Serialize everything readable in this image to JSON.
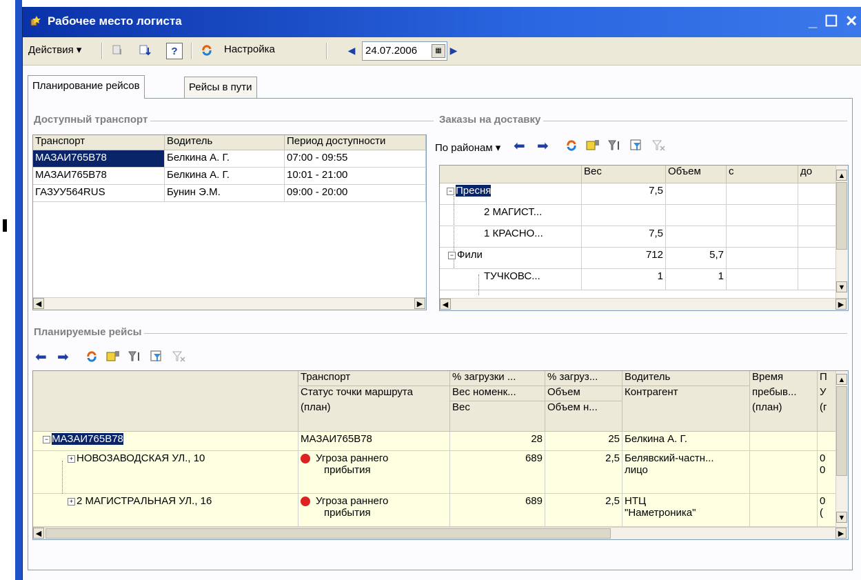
{
  "window": {
    "title": "Рабочее место логиста"
  },
  "toolbar": {
    "actions_label": "Действия ▾",
    "help_label": "?",
    "settings_label": "Настройка",
    "date": "24.07.2006"
  },
  "tabs": [
    {
      "label": "Планирование рейсов",
      "active": true
    },
    {
      "label": "Рейсы в пути",
      "active": false
    }
  ],
  "transport": {
    "group_label": "Доступный транспорт",
    "columns": [
      "Транспорт",
      "Водитель",
      "Период доступности"
    ],
    "rows": [
      [
        "МАЗАИ765В78",
        "Белкина А. Г.",
        "07:00 - 09:55"
      ],
      [
        "МАЗАИ765В78",
        "Белкина А. Г.",
        "10:01 - 21:00"
      ],
      [
        "ГАЗУУ564RUS",
        "Бунин Э.М.",
        "09:00 - 20:00"
      ]
    ]
  },
  "orders": {
    "group_label": "Заказы на доставку",
    "mode_label": "По районам ▾",
    "columns": [
      "",
      "Вес",
      "Объем",
      "с",
      "до"
    ],
    "rows": [
      {
        "name": "Пресня",
        "level": 0,
        "weight": "7,5",
        "volume": ""
      },
      {
        "name": "2 МАГИСТ...",
        "level": 1,
        "weight": "",
        "volume": ""
      },
      {
        "name": "1 КРАСНО...",
        "level": 1,
        "weight": "7,5",
        "volume": ""
      },
      {
        "name": "Фили",
        "level": 0,
        "weight": "712",
        "volume": "5,7"
      },
      {
        "name": "ТУЧКОВС...",
        "level": 1,
        "weight": "1",
        "volume": "1"
      }
    ]
  },
  "trips": {
    "group_label": "Планируемые рейсы",
    "headers": {
      "col2": [
        "Транспорт",
        "Статус точки маршрута",
        "(план)"
      ],
      "col3": [
        "% загрузки ...",
        "Вес номенк...",
        "Вес"
      ],
      "col4": [
        "% загруз...",
        "Объем",
        "Объем н..."
      ],
      "col5": [
        "Водитель",
        "Контрагент"
      ],
      "col6": [
        "Время",
        "пребыв...",
        "(план)"
      ],
      "col7": [
        "П",
        "У",
        "(г"
      ]
    },
    "rows": [
      {
        "name": "МАЗАИ765В78",
        "c2": "МАЗАИ765В78",
        "c3": "28",
        "c4": "25",
        "c5": "Белкина А. Г.",
        "c5b": "",
        "c7a": "",
        "c7b": ""
      },
      {
        "name": "НОВОЗАВОДСКАЯ УЛ., 10",
        "c2": "Угроза раннего",
        "c2b": "прибытия",
        "c3": "689",
        "c4": "2,5",
        "c5": "Белявский-частн...",
        "c5b": "лицо",
        "c7a": "0",
        "c7b": "0"
      },
      {
        "name": "2 МАГИСТРАЛЬНАЯ УЛ., 16",
        "c2": "Угроза раннего",
        "c2b": "прибытия",
        "c3": "689",
        "c4": "2,5",
        "c5": "НТЦ",
        "c5b": "\"Наметроника\"",
        "c7a": "0",
        "c7b": "("
      }
    ]
  },
  "colors": {
    "accent": "#0a246a",
    "title_bar": "#2a66e0",
    "highlight_row": "#ffffe1"
  }
}
